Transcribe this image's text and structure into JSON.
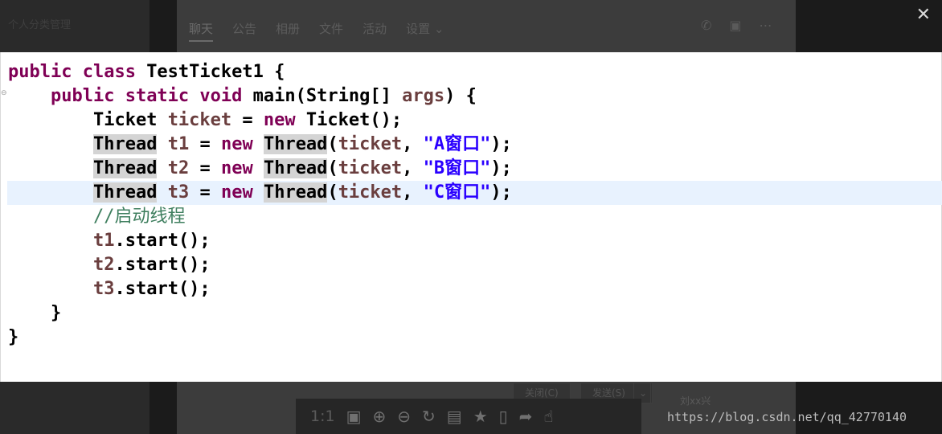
{
  "background": {
    "left_title": "个人分类管理",
    "tabs": [
      "聊天",
      "公告",
      "相册",
      "文件",
      "活动",
      "设置"
    ],
    "tab_dropdown_arrow": "⌄",
    "icons": [
      "phone-icon",
      "message-plus-icon",
      "more-icon"
    ],
    "close_button": "关闭(C)",
    "send_button": "发送(S)",
    "send_dropdown_arrow": "⌄",
    "user_name": "刘xx兴"
  },
  "viewer": {
    "close_icon": "✕",
    "toolbar": {
      "zoom_level": "1:1",
      "icons": [
        "fit-screen-icon",
        "zoom-in-icon",
        "zoom-out-icon",
        "rotate-icon",
        "save-icon",
        "bookmark-icon",
        "phone-icon",
        "share-icon",
        "like-icon"
      ]
    },
    "watermark": "https://blog.csdn.net/qq_42770140"
  },
  "code": {
    "lines": [
      {
        "indent": "",
        "tokens": [
          {
            "t": "public class ",
            "c": "kw"
          },
          {
            "t": "TestTicket1 {",
            "c": ""
          }
        ]
      },
      {
        "indent": "    ",
        "tokens": [
          {
            "t": "public static void ",
            "c": "kw"
          },
          {
            "t": "main(String[] ",
            "c": ""
          },
          {
            "t": "args",
            "c": "var"
          },
          {
            "t": ") {",
            "c": ""
          }
        ]
      },
      {
        "indent": "        ",
        "tokens": [
          {
            "t": "Ticket ",
            "c": ""
          },
          {
            "t": "ticket",
            "c": "var"
          },
          {
            "t": " = ",
            "c": ""
          },
          {
            "t": "new",
            "c": "kw"
          },
          {
            "t": " Ticket();",
            "c": ""
          }
        ]
      },
      {
        "indent": "        ",
        "tokens": [
          {
            "t": "Thread",
            "c": "hl"
          },
          {
            "t": " ",
            "c": ""
          },
          {
            "t": "t1",
            "c": "var"
          },
          {
            "t": " = ",
            "c": ""
          },
          {
            "t": "new",
            "c": "kw"
          },
          {
            "t": " ",
            "c": ""
          },
          {
            "t": "Thread",
            "c": "hl"
          },
          {
            "t": "(",
            "c": ""
          },
          {
            "t": "ticket",
            "c": "var"
          },
          {
            "t": ", ",
            "c": ""
          },
          {
            "t": "\"A窗口\"",
            "c": "str"
          },
          {
            "t": ");",
            "c": ""
          }
        ]
      },
      {
        "indent": "        ",
        "tokens": [
          {
            "t": "Thread",
            "c": "hl"
          },
          {
            "t": " ",
            "c": ""
          },
          {
            "t": "t2",
            "c": "var"
          },
          {
            "t": " = ",
            "c": ""
          },
          {
            "t": "new",
            "c": "kw"
          },
          {
            "t": " ",
            "c": ""
          },
          {
            "t": "Thread",
            "c": "hl"
          },
          {
            "t": "(",
            "c": ""
          },
          {
            "t": "ticket",
            "c": "var"
          },
          {
            "t": ", ",
            "c": ""
          },
          {
            "t": "\"B窗口\"",
            "c": "str"
          },
          {
            "t": ");",
            "c": ""
          }
        ]
      },
      {
        "indent": "        ",
        "current": true,
        "tokens": [
          {
            "t": "Thread",
            "c": "hl"
          },
          {
            "t": " ",
            "c": ""
          },
          {
            "t": "t3",
            "c": "var"
          },
          {
            "t": " = ",
            "c": ""
          },
          {
            "t": "new",
            "c": "kw"
          },
          {
            "t": " ",
            "c": ""
          },
          {
            "t": "Thread",
            "c": "hl"
          },
          {
            "t": "(",
            "c": ""
          },
          {
            "t": "ticket",
            "c": "var"
          },
          {
            "t": ", ",
            "c": ""
          },
          {
            "t": "\"C窗口\"",
            "c": "str"
          },
          {
            "t": ");",
            "c": ""
          }
        ]
      },
      {
        "indent": "        ",
        "tokens": [
          {
            "t": "//启动线程",
            "c": "cm"
          }
        ]
      },
      {
        "indent": "        ",
        "tokens": [
          {
            "t": "t1",
            "c": "var"
          },
          {
            "t": ".start();",
            "c": ""
          }
        ]
      },
      {
        "indent": "        ",
        "tokens": [
          {
            "t": "t2",
            "c": "var"
          },
          {
            "t": ".start();",
            "c": ""
          }
        ]
      },
      {
        "indent": "        ",
        "tokens": [
          {
            "t": "t3",
            "c": "var"
          },
          {
            "t": ".start();",
            "c": ""
          }
        ]
      },
      {
        "indent": "    ",
        "tokens": [
          {
            "t": "}",
            "c": ""
          }
        ]
      },
      {
        "indent": "",
        "tokens": [
          {
            "t": "}",
            "c": ""
          }
        ]
      }
    ]
  }
}
